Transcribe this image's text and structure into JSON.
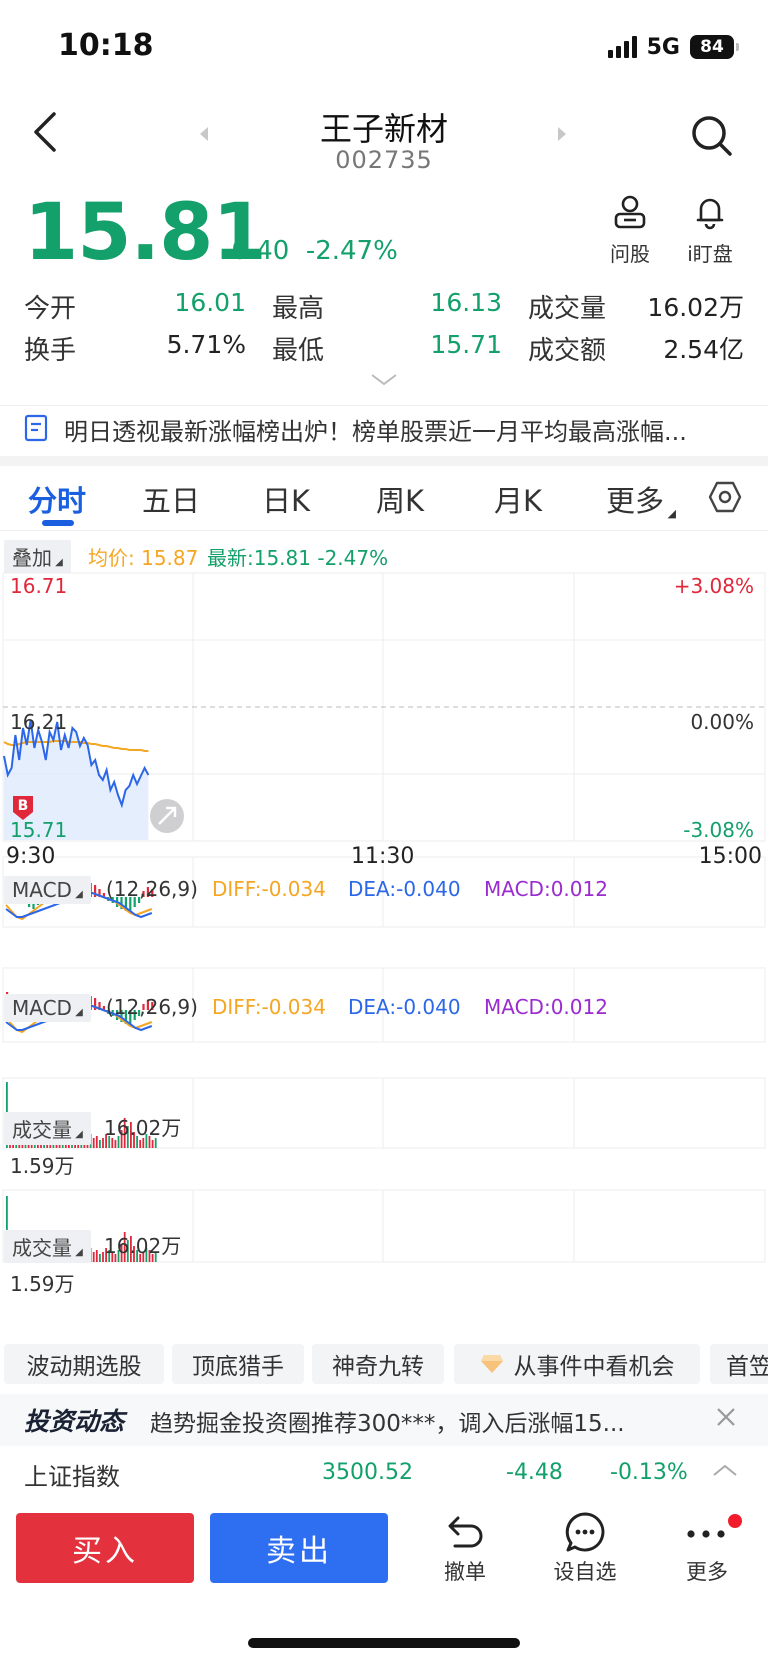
{
  "status_bar": {
    "time": "10:18",
    "network": "5G",
    "battery": "84"
  },
  "header": {
    "title": "王子新材",
    "code": "002735"
  },
  "quote": {
    "price": "15.81",
    "change": "-0.40",
    "change_pct": "-2.47%",
    "actions": [
      {
        "label": "问股"
      },
      {
        "label": "i盯盘"
      }
    ]
  },
  "stats": {
    "row1": [
      {
        "label": "今开",
        "value": "16.01"
      },
      {
        "label": "最高",
        "value": "16.13"
      },
      {
        "label": "成交量",
        "value": "16.02万"
      }
    ],
    "row2": [
      {
        "label": "换手",
        "value": "5.71%"
      },
      {
        "label": "最低",
        "value": "15.71"
      },
      {
        "label": "成交额",
        "value": "2.54亿"
      }
    ]
  },
  "news": {
    "text": "明日透视最新涨幅榜出炉！榜单股票近一月平均最高涨幅..."
  },
  "tabs": [
    "分时",
    "五日",
    "日K",
    "周K",
    "月K",
    "更多"
  ],
  "overlay": {
    "pill": "叠加",
    "avg_label": "均价: 15.87",
    "latest_label": "最新:15.81 -2.47%"
  },
  "price_chart": {
    "y_top": "16.71",
    "y_mid": "16.21",
    "y_bottom": "15.71",
    "pct_top": "+3.08%",
    "pct_mid": "0.00%",
    "pct_bottom": "-3.08%",
    "x_labels": [
      "9:30",
      "11:30",
      "15:00"
    ],
    "marker": "B"
  },
  "macd_panels": [
    {
      "pill": "MACD",
      "params": "(12,26,9)",
      "diff": "DIFF:-0.034",
      "dea": "DEA:-0.040",
      "macd": "MACD:0.012"
    },
    {
      "pill": "MACD",
      "params": "(12,26,9)",
      "diff": "DIFF:-0.034",
      "dea": "DEA:-0.040",
      "macd": "MACD:0.012"
    }
  ],
  "volume_panels": [
    {
      "pill": "成交量",
      "total": "16.02万",
      "peak": "1.59万"
    },
    {
      "pill": "成交量",
      "total": "16.02万",
      "peak": "1.59万"
    }
  ],
  "chips": [
    "波动期选股",
    "顶底猎手",
    "神奇九转",
    "从事件中看机会",
    "首笠"
  ],
  "invest": {
    "logo": "投资动态",
    "text": "趋势掘金投资圈推荐300***，调入后涨幅15..."
  },
  "index": {
    "name": "上证指数",
    "value": "3500.52",
    "change": "-4.48",
    "pct": "-0.13%"
  },
  "bottom": {
    "buy": "买入",
    "sell": "卖出",
    "cancel": "撤单",
    "watch": "设自选",
    "more": "更多"
  },
  "colors": {
    "down": "#13a06b",
    "up": "#e0283a",
    "accent": "#1a5fe0",
    "buy": "#e3323e",
    "sell": "#2e6ef0"
  }
}
